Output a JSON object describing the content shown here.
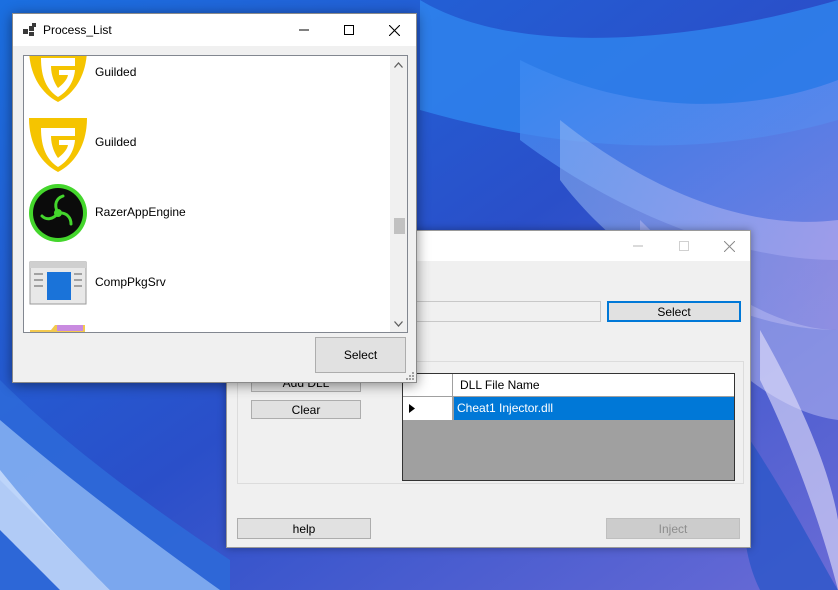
{
  "process_window": {
    "title": "Process_List",
    "processes": [
      {
        "name": "Guilded",
        "icon": "guilded-icon"
      },
      {
        "name": "Guilded",
        "icon": "guilded-icon"
      },
      {
        "name": "RazerAppEngine",
        "icon": "razer-icon"
      },
      {
        "name": "CompPkgSrv",
        "icon": "window-app-icon"
      },
      {
        "name": "",
        "icon": "folder-icon"
      }
    ],
    "select_label": "Select"
  },
  "injector_window": {
    "select_label": "Select",
    "add_dll_label": "Add DLL",
    "clear_label": "Clear",
    "grid": {
      "column_header": "DLL File Name",
      "rows": [
        "Cheat1 Injector.dll"
      ]
    },
    "help_label": "help",
    "inject_label": "Inject"
  },
  "colors": {
    "accent": "#0078d7",
    "guilded": "#f5c400",
    "razer": "#44d62c"
  }
}
